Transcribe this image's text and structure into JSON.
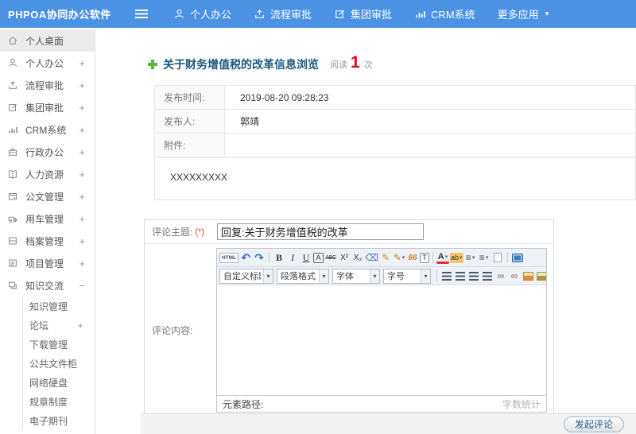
{
  "colors": {
    "topbar_bg": "#4b92e4",
    "title_color": "#1b5a7d",
    "accent_red": "#e60012",
    "plus_green": "#56b837"
  },
  "topbar": {
    "logo": "PHPOA协同办公软件",
    "nav": [
      {
        "name": "personal-office",
        "icon": "person",
        "label": "个人办公"
      },
      {
        "name": "process-approval",
        "icon": "process",
        "label": "流程审批"
      },
      {
        "name": "group-approval",
        "icon": "edit",
        "label": "集团审批"
      },
      {
        "name": "crm-system",
        "icon": "chart",
        "label": "CRM系统"
      },
      {
        "name": "more-apps",
        "icon": "",
        "label": "更多应用",
        "has_dropdown": true
      }
    ]
  },
  "sidebar": {
    "expand_glyph": "+",
    "collapse_glyph": "−",
    "items": [
      {
        "name": "personal-desktop",
        "icon": "home",
        "label": "个人桌面",
        "active": true
      },
      {
        "name": "personal-office",
        "icon": "person",
        "label": "个人办公",
        "expandable": true
      },
      {
        "name": "process-approval",
        "icon": "process",
        "label": "流程审批",
        "expandable": true
      },
      {
        "name": "group-approval",
        "icon": "edit",
        "label": "集团审批",
        "expandable": true
      },
      {
        "name": "crm-system",
        "icon": "chart",
        "label": "CRM系统",
        "expandable": true
      },
      {
        "name": "admin-office",
        "icon": "briefcase",
        "label": "行政办公",
        "expandable": true
      },
      {
        "name": "human-resources",
        "icon": "book",
        "label": "人力资源",
        "expandable": true
      },
      {
        "name": "document-mgmt",
        "icon": "document",
        "label": "公文管理",
        "expandable": true
      },
      {
        "name": "vehicle-mgmt",
        "icon": "car",
        "label": "用车管理",
        "expandable": true
      },
      {
        "name": "archive-mgmt",
        "icon": "archive",
        "label": "档案管理",
        "expandable": true
      },
      {
        "name": "project-mgmt",
        "icon": "project",
        "label": "项目管理",
        "expandable": true
      },
      {
        "name": "knowledge-exchange",
        "icon": "chat",
        "label": "知识交流",
        "expanded": true
      }
    ],
    "subitems": [
      {
        "name": "knowledge-mgmt",
        "label": "知识管理"
      },
      {
        "name": "forum",
        "label": "论坛",
        "expandable": true
      },
      {
        "name": "download-mgmt",
        "label": "下载管理"
      },
      {
        "name": "public-file-cabinet",
        "label": "公共文件柜"
      },
      {
        "name": "network-disk",
        "label": "网络硬盘"
      },
      {
        "name": "rules-regulations",
        "label": "规章制度"
      },
      {
        "name": "e-journal",
        "label": "电子期刊"
      }
    ]
  },
  "article": {
    "title": "关于财务增值税的改革信息浏览",
    "read_label": "阅读",
    "read_count": "1",
    "read_unit": "次",
    "info_rows": [
      {
        "label": "发布时间:",
        "value": "2019-08-20 09:28:23"
      },
      {
        "label": "发布人:",
        "value": "郭靖"
      },
      {
        "label": "附件:",
        "value": ""
      }
    ],
    "content": "XXXXXXXXX"
  },
  "comment_form": {
    "subject_label": "评论主题:",
    "required_mark": "(*)",
    "subject_value": "回复:关于财务增值税的改革",
    "content_label": "评论内容:",
    "editor": {
      "toolbar_row1": [
        {
          "name": "html-source",
          "text": "HTML"
        },
        {
          "name": "undo",
          "text": "↶"
        },
        {
          "name": "redo",
          "text": "↷"
        },
        {
          "type": "sep"
        },
        {
          "name": "bold",
          "text": "B"
        },
        {
          "name": "italic",
          "text": "I"
        },
        {
          "name": "underline",
          "text": "U"
        },
        {
          "name": "font-style-box",
          "text": "A"
        },
        {
          "name": "strikethrough",
          "text": "ABC"
        },
        {
          "name": "superscript",
          "text": "X²"
        },
        {
          "name": "subscript",
          "text": "X₂"
        },
        {
          "name": "eraser",
          "text": "⌫"
        },
        {
          "name": "format-brush",
          "text": "✎"
        },
        {
          "name": "graffiti-pen",
          "text": "✎",
          "dropdown": true
        },
        {
          "name": "blockquote",
          "text": "66"
        },
        {
          "name": "paste-as-text",
          "text": "T"
        },
        {
          "type": "sep"
        },
        {
          "name": "font-color",
          "text": "A",
          "dropdown": true
        },
        {
          "name": "highlight-color",
          "text": "ab",
          "dropdown": true
        },
        {
          "name": "ordered-list",
          "text": "≡",
          "dropdown": true
        },
        {
          "name": "unordered-list",
          "text": "≡",
          "dropdown": true
        },
        {
          "name": "new-document",
          "shape": true
        },
        {
          "type": "sep"
        },
        {
          "name": "fullscreen",
          "shape": true
        }
      ],
      "toolbar_selects": [
        {
          "name": "heading",
          "label": "自定义标题"
        },
        {
          "name": "paragraph",
          "label": "段落格式"
        },
        {
          "name": "font",
          "label": "字体"
        },
        {
          "name": "size",
          "label": "字号"
        }
      ],
      "toolbar_row2_icons": [
        {
          "name": "align-left"
        },
        {
          "name": "align-center"
        },
        {
          "name": "align-right"
        },
        {
          "name": "align-justify"
        },
        {
          "name": "link"
        },
        {
          "name": "unlink"
        },
        {
          "name": "image"
        },
        {
          "name": "multi-image"
        },
        {
          "name": "media"
        },
        {
          "name": "table"
        }
      ],
      "status_left": "元素路径:",
      "status_right": "字数统计"
    },
    "submit_label": "发起评论"
  }
}
